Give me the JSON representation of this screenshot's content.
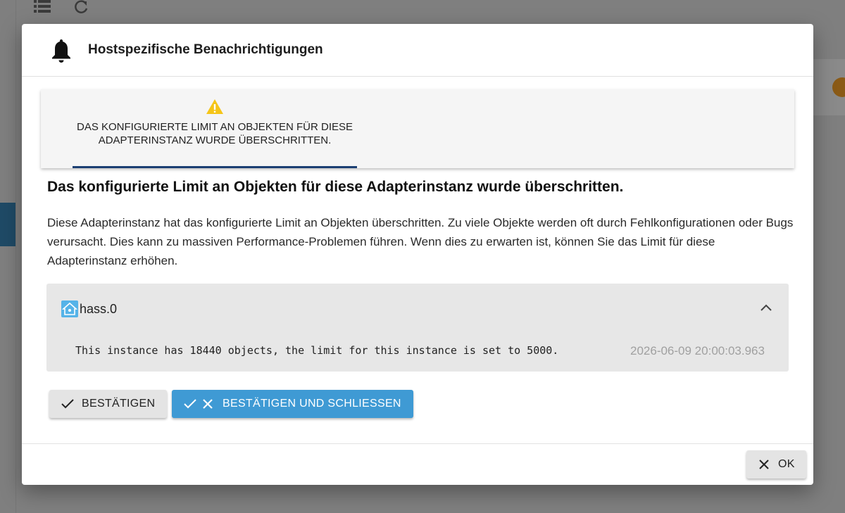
{
  "background": {
    "toolbar_icons": [
      "list-icon",
      "refresh-icon"
    ]
  },
  "dialog": {
    "title": "Hostspezifische Benachrichtigungen",
    "title_icon": "bell-icon",
    "tabs": [
      {
        "label": "DAS KONFIGURIERTE LIMIT AN OBJEKTEN FÜR DIESE ADAPTERINSTANZ WURDE ÜBERSCHRITTEN.",
        "icon": "warning-icon",
        "active": true
      }
    ],
    "section_title": "Das konfigurierte Limit an Objekten für diese Adapterinstanz wurde überschritten.",
    "section_description": "Diese Adapterinstanz hat das konfigurierte Limit an Objekten überschritten. Zu viele Objekte werden oft durch Fehlkonfigurationen oder Bugs verursacht. Dies kann zu massiven Performance-Problemen führen. Wenn dies zu erwarten ist, können Sie das Limit für diese Adapterinstanz erhöhen.",
    "instance": {
      "name": "hass.0",
      "expanded": true,
      "message": "This instance has 18440 objects, the limit for this instance is set to 5000.",
      "timestamp": "2026-06-09 20:00:03.963"
    },
    "buttons": {
      "confirm": "BESTÄTIGEN",
      "confirm_close": "BESTÄTIGEN UND SCHLIESSEN",
      "ok": "OK"
    }
  },
  "colors": {
    "primary": "#3f9ad4",
    "tab_indicator": "#1b3f73",
    "warning": "#f5c518"
  }
}
